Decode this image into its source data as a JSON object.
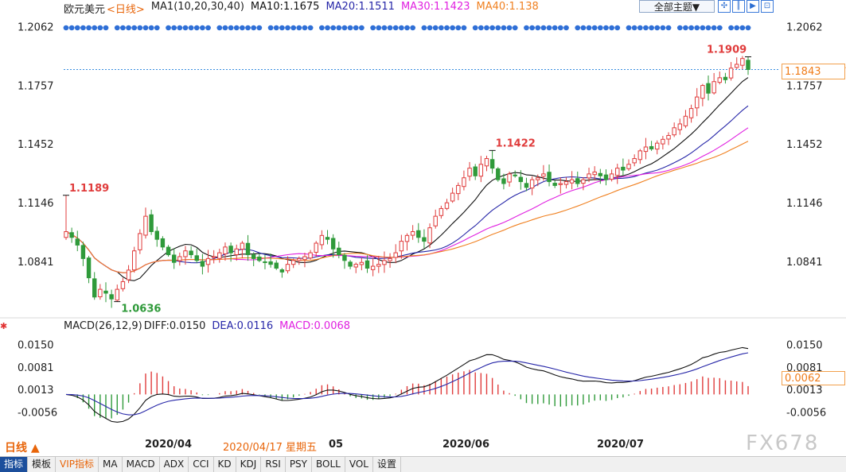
{
  "header": {
    "symbol": "欧元美元",
    "period_tag": "<日线>",
    "ma_title": "MA1(10,20,30,40)",
    "ma10": "MA10:1.1675",
    "ma20": "MA20:1.1511",
    "ma30": "MA30:1.1423",
    "ma40": "MA40:1.138",
    "theme_button": "全部主题▼"
  },
  "macd_header": {
    "title": "MACD(26,12,9)",
    "diff": "DIFF:0.0150",
    "dea": "DEA:0.0116",
    "macd": "MACD:0.0068"
  },
  "price_box": "1.1843",
  "macd_box": "0.0062",
  "period_label": "日线 ▲",
  "crosshair_date": "2020/04/17 星期五",
  "watermark": "FX678",
  "x_labels": [
    "2020/04",
    "05",
    "2020/06",
    "2020/07"
  ],
  "bottom_tabs": [
    "指标",
    "模板",
    "VIP指标",
    "MA",
    "MACD",
    "ADX",
    "CCI",
    "KD",
    "KDJ",
    "RSI",
    "PSY",
    "BOLL",
    "VOL",
    "设置"
  ],
  "colors": {
    "up": "#e03c3c",
    "down": "#2f9a3a",
    "ma10": "#111111",
    "ma20": "#2626a8",
    "ma30": "#e020e0",
    "ma40": "#f08020",
    "dotted": "#2f6fd6",
    "current": "#3a8fe0"
  },
  "chart_data": [
    {
      "type": "candlestick",
      "title": "欧元美元 日线",
      "ylim": [
        1.056,
        1.213
      ],
      "y_ticks": [
        "1.2062",
        "1.1757",
        "1.1452",
        "1.1146",
        "1.0841"
      ],
      "y_tick_values": [
        1.2062,
        1.1757,
        1.1452,
        1.1146,
        1.0841
      ],
      "current_price": 1.1843,
      "annotations": [
        {
          "label": "1.1189",
          "index": 0,
          "value": 1.1189
        },
        {
          "label": "1.0636",
          "index": 9,
          "value": 1.0636
        },
        {
          "label": "1.1422",
          "index": 75,
          "value": 1.1422
        },
        {
          "label": "1.1909",
          "index": 120,
          "value": 1.1909
        }
      ],
      "x_axis_labels": [
        {
          "label": "2020/04",
          "index": 22
        },
        {
          "label": "05",
          "index": 44
        },
        {
          "label": "2020/06",
          "index": 66
        },
        {
          "label": "2020/07",
          "index": 88
        }
      ],
      "ma_periods": [
        10,
        20,
        30,
        40
      ],
      "closes": [
        1.1,
        1.097,
        1.093,
        1.086,
        1.076,
        1.066,
        1.07,
        1.068,
        1.065,
        1.07,
        1.074,
        1.08,
        1.09,
        1.099,
        1.108,
        1.1,
        1.096,
        1.092,
        1.088,
        1.084,
        1.087,
        1.09,
        1.088,
        1.085,
        1.082,
        1.086,
        1.087,
        1.089,
        1.092,
        1.089,
        1.091,
        1.094,
        1.088,
        1.086,
        1.085,
        1.084,
        1.083,
        1.081,
        1.079,
        1.083,
        1.085,
        1.086,
        1.087,
        1.089,
        1.094,
        1.098,
        1.096,
        1.091,
        1.088,
        1.085,
        1.082,
        1.083,
        1.084,
        1.081,
        1.082,
        1.083,
        1.085,
        1.086,
        1.089,
        1.095,
        1.098,
        1.1,
        1.097,
        1.095,
        1.102,
        1.108,
        1.112,
        1.115,
        1.12,
        1.124,
        1.128,
        1.133,
        1.129,
        1.135,
        1.138,
        1.133,
        1.127,
        1.125,
        1.13,
        1.129,
        1.126,
        1.123,
        1.127,
        1.128,
        1.13,
        1.126,
        1.124,
        1.125,
        1.126,
        1.127,
        1.125,
        1.127,
        1.13,
        1.131,
        1.129,
        1.127,
        1.13,
        1.133,
        1.132,
        1.135,
        1.138,
        1.142,
        1.144,
        1.143,
        1.146,
        1.148,
        1.15,
        1.154,
        1.156,
        1.16,
        1.164,
        1.17,
        1.176,
        1.172,
        1.178,
        1.18,
        1.179,
        1.185,
        1.187,
        1.19,
        1.1843
      ],
      "macd": {
        "ylim": [
          -0.0125,
          0.0185
        ],
        "y_ticks": [
          "0.0150",
          "0.0081",
          "0.0013",
          "-0.0056"
        ],
        "y_tick_values": [
          0.015,
          0.0081,
          0.0013,
          -0.0056
        ],
        "diff_last": 0.015,
        "dea_last": 0.0116,
        "macd_last": 0.0068
      }
    }
  ]
}
